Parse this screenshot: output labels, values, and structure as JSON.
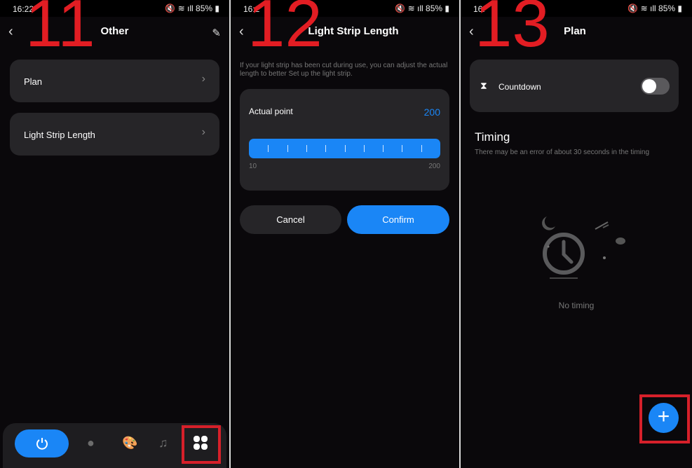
{
  "annotations": {
    "step1": "11",
    "step2": "12",
    "step3": "13",
    "highlight_color": "#e21d23"
  },
  "status": {
    "time1": "16:22",
    "time2": "16:2",
    "time3": "16:",
    "battery": "85%",
    "icons": [
      "mute-icon",
      "wifi-icon",
      "volte-icon",
      "signal-icon",
      "battery-icon"
    ]
  },
  "screen1": {
    "title": "Other",
    "items": [
      {
        "label": "Plan"
      },
      {
        "label": "Light Strip Length"
      }
    ],
    "nav": [
      "power-icon",
      "bulb-icon",
      "palette-icon",
      "music-icon",
      "grid-icon"
    ]
  },
  "screen2": {
    "title": "Light Strip Length",
    "description": "If your light strip has been cut during use, you can adjust the actual length to better Set up the light strip.",
    "slider_label": "Actual point",
    "value": "200",
    "min": "10",
    "max": "200",
    "cancel": "Cancel",
    "confirm": "Confirm",
    "accent": "#1a86f6"
  },
  "screen3": {
    "title": "Plan",
    "countdown_label": "Countdown",
    "countdown_on": false,
    "section_title": "Timing",
    "section_note": "There may be an error of about 30 seconds in the timing",
    "empty_text": "No timing"
  }
}
